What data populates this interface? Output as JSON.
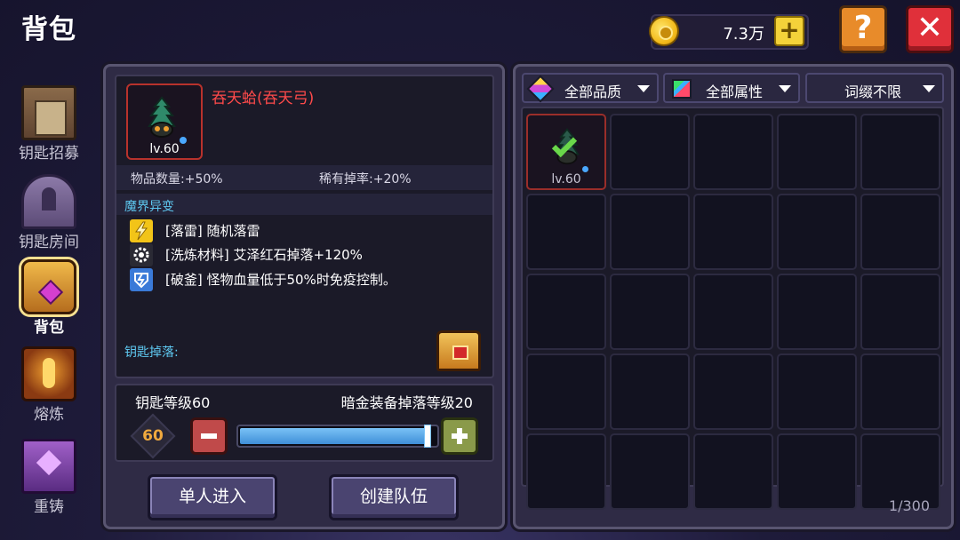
{
  "header": {
    "title": "背包",
    "currency_value": "7.3万"
  },
  "sidebar": {
    "items": [
      {
        "label": "钥匙招募",
        "icon": "recruit-icon",
        "active": false
      },
      {
        "label": "钥匙房间",
        "icon": "key-room-icon",
        "active": false
      },
      {
        "label": "背包",
        "icon": "backpack-icon",
        "active": true
      },
      {
        "label": "熔炼",
        "icon": "smelt-icon",
        "active": false
      },
      {
        "label": "重铸",
        "icon": "recast-icon",
        "active": false
      }
    ]
  },
  "detail": {
    "item_name": "吞天蛤(吞天弓)",
    "item_level": "lv.60",
    "stats": {
      "quantity": "物品数量:+50%",
      "rare_drop": "稀有掉率:+20%"
    },
    "section_title": "魔界异变",
    "traits": [
      {
        "text": "[落雷] 随机落雷",
        "icon": "lightning-icon",
        "color": "#f2c418"
      },
      {
        "text": "[洗炼材料] 艾泽红石掉落+120%",
        "icon": "gear-icon",
        "color": "#2a2a34"
      },
      {
        "text": "[破釜] 怪物血量低于50%时免疫控制。",
        "icon": "shield-break-icon",
        "color": "#3a7ad8"
      }
    ],
    "drops_label": "钥匙掉落:",
    "key_level_label": "钥匙等级60",
    "drop_level_label": "暗金装备掉落等级20",
    "level_value": "60",
    "level_fraction": 0.97
  },
  "actions": {
    "solo": "单人进入",
    "create_team": "创建队伍"
  },
  "inventory": {
    "filters": {
      "quality": "全部品质",
      "attribute": "全部属性",
      "affix": "词缀不限"
    },
    "slots": [
      {
        "filled": true,
        "level": "lv.60"
      }
    ],
    "capacity": "1/300"
  },
  "colors": {
    "item_name": "#ff4a4a",
    "section_title": "#5ec8f0",
    "level_value": "#f0a93e",
    "rare_border": "#b8322c"
  }
}
